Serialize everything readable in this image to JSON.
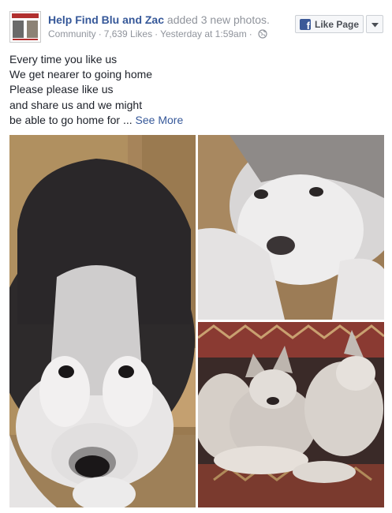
{
  "header": {
    "page_name": "Help Find Blu and Zac",
    "action": " added 3 new photos.",
    "category": "Community",
    "likes": "7,639 Likes",
    "timestamp": "Yesterday at 1:59am",
    "privacy_icon": "globe-icon"
  },
  "like_button": {
    "label": "Like Page",
    "icon": "facebook-f-icon",
    "menu_icon": "caret-down-icon"
  },
  "post": {
    "lines": [
      "Every time you like us",
      "We get nearer to going home",
      "Please please like us",
      "and share us and we might"
    ],
    "last_line": "be able to go home for ... ",
    "see_more": "See More"
  },
  "colors": {
    "link": "#365899",
    "muted": "#90949c",
    "facebook_blue": "#3b5998"
  }
}
